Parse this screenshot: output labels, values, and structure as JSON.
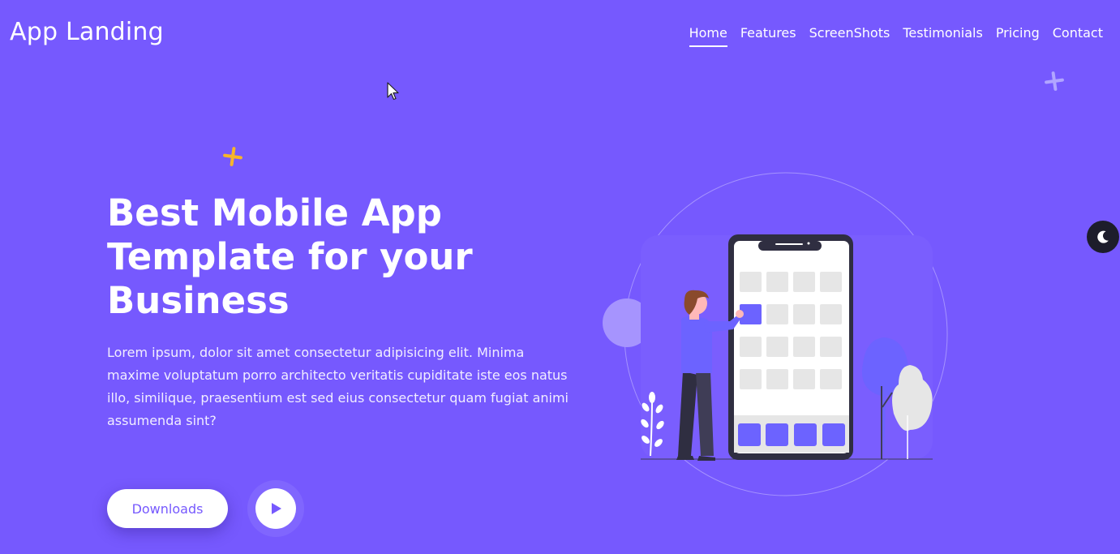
{
  "header": {
    "brand": "App Landing",
    "nav": [
      {
        "label": "Home",
        "active": true
      },
      {
        "label": "Features"
      },
      {
        "label": "ScreenShots"
      },
      {
        "label": "Testimonials"
      },
      {
        "label": "Pricing"
      },
      {
        "label": "Contact"
      }
    ]
  },
  "hero": {
    "title": "Best Mobile App Template for your Business",
    "text": "Lorem ipsum, dolor sit amet consectetur adipisicing elit. Minima maxime voluptatum porro architecto veritatis cupiditate iste eos natus illo, similique, praesentium est sed eius consectetur quam fugiat animi assumenda sint?",
    "download_label": "Downloads",
    "play_icon": "play-icon"
  },
  "theme_toggle_icon": "moon-icon",
  "colors": {
    "background": "#7659fe",
    "accent": "#6c63ff",
    "deco_yellow": "#f7b52a"
  }
}
